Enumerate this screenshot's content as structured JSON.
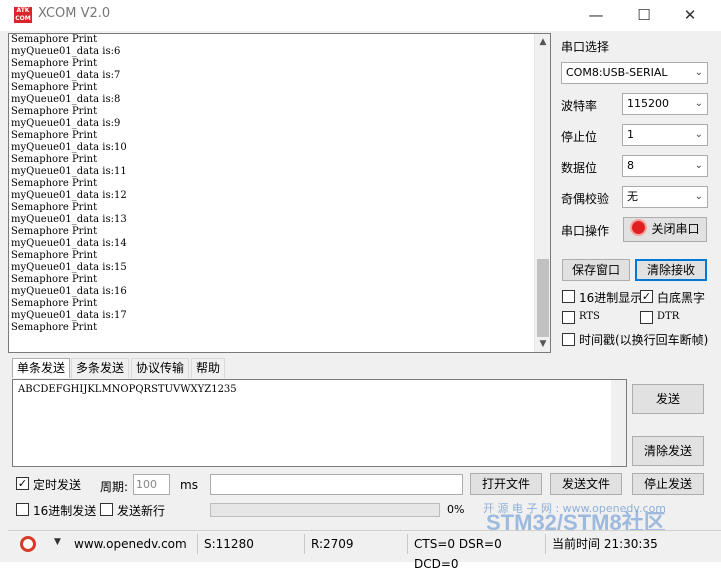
{
  "window": {
    "title": "XCOM V2.0",
    "logo_text": "ATK COM"
  },
  "receive": {
    "lines": [
      "Semaphore Print",
      "myQueue01_data is:6",
      "Semaphore Print",
      "myQueue01_data is:7",
      "Semaphore Print",
      "myQueue01_data is:8",
      "Semaphore Print",
      "myQueue01_data is:9",
      "Semaphore Print",
      "myQueue01_data is:10",
      "Semaphore Print",
      "myQueue01_data is:11",
      "Semaphore Print",
      "myQueue01_data is:12",
      "Semaphore Print",
      "myQueue01_data is:13",
      "Semaphore Print",
      "myQueue01_data is:14",
      "Semaphore Print",
      "myQueue01_data is:15",
      "Semaphore Print",
      "myQueue01_data is:16",
      "Semaphore Print",
      "myQueue01_data is:17",
      "Semaphore Print"
    ]
  },
  "settings": {
    "port_label": "串口选择",
    "port_value": "COM8:USB-SERIAL",
    "baud_label": "波特率",
    "baud_value": "115200",
    "stop_label": "停止位",
    "stop_value": "1",
    "data_label": "数据位",
    "data_value": "8",
    "parity_label": "奇偶校验",
    "parity_value": "无",
    "op_label": "串口操作",
    "close_port_label": "关闭串口",
    "save_window_label": "保存窗口",
    "clear_receive_label": "清除接收",
    "hex_display_label": "16进制显示",
    "white_black_label": "白底黑字",
    "rts_label": "RTS",
    "dtr_label": "DTR",
    "timestamp_label": "时间戳(以换行回车断帧)"
  },
  "tabs": [
    "单条发送",
    "多条发送",
    "协议传输",
    "帮助"
  ],
  "send": {
    "text": "ABCDEFGHIJKLMNOPQRSTUVWXYZ1235",
    "send_label": "发送",
    "clear_send_label": "清除发送",
    "timed_send_label": "定时发送",
    "period_label": "周期:",
    "period_value": "100",
    "ms_label": "ms",
    "hex_send_label": "16进制发送",
    "newline_label": "发送新行",
    "open_file_label": "打开文件",
    "send_file_label": "发送文件",
    "stop_send_label": "停止发送",
    "progress_text": "0%",
    "progress_value": 0
  },
  "watermark": {
    "line1": "开 源 电 子 网 :  www.openedv.com",
    "line2": "STM32/STM8社区"
  },
  "status": {
    "website": "www.openedv.com",
    "sent": "S:11280",
    "received": "R:2709",
    "signals": "CTS=0 DSR=0 DCD=0",
    "time": "当前时间 21:30:35"
  }
}
